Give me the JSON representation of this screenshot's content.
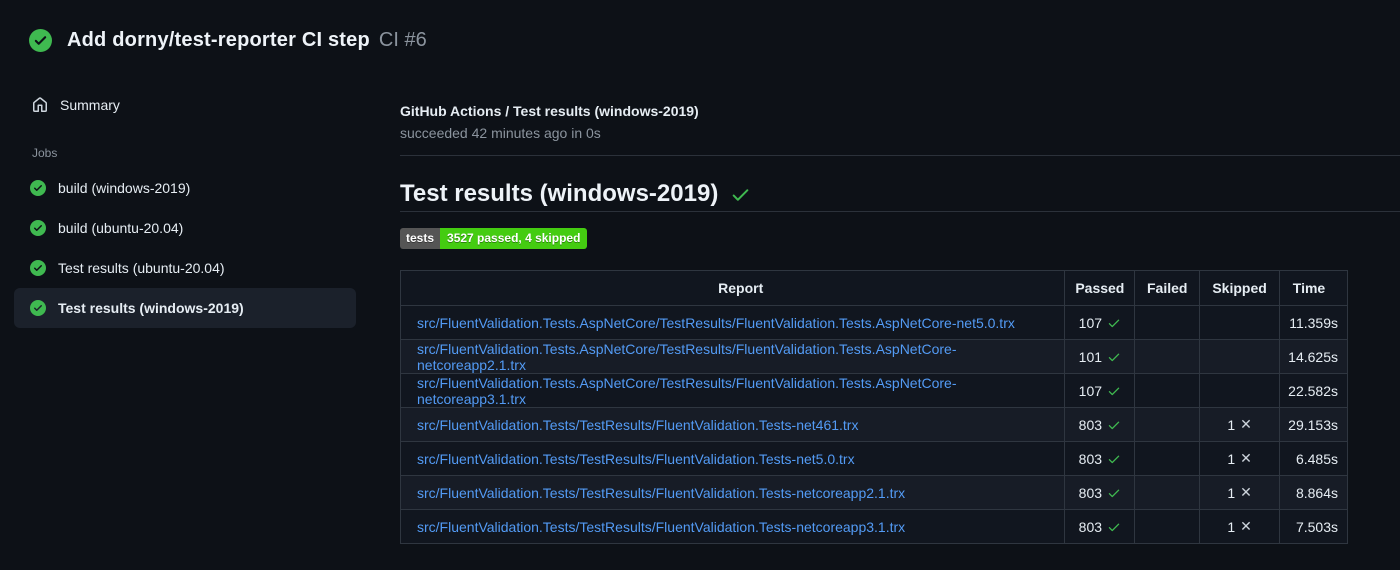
{
  "run_header": {
    "title": "Add dorny/test-reporter CI step",
    "run_number": "CI #6",
    "status": "success"
  },
  "sidebar": {
    "summary_label": "Summary",
    "jobs_label": "Jobs",
    "jobs": [
      {
        "label": "build (windows-2019)",
        "status": "success",
        "selected": false
      },
      {
        "label": "build (ubuntu-20.04)",
        "status": "success",
        "selected": false
      },
      {
        "label": "Test results (ubuntu-20.04)",
        "status": "success",
        "selected": false
      },
      {
        "label": "Test results (windows-2019)",
        "status": "success",
        "selected": true
      }
    ]
  },
  "check_header": {
    "title": "GitHub Actions / Test results (windows-2019)",
    "status_line": "succeeded 42 minutes ago in 0s"
  },
  "report": {
    "heading": "Test results (windows-2019)",
    "heading_status": "success",
    "badge": {
      "label": "tests",
      "value": "3527 passed, 4 skipped",
      "label_bg": "#555555",
      "value_bg": "#44cc11"
    },
    "table": {
      "columns": [
        "Report",
        "Passed",
        "Failed",
        "Skipped",
        "Time"
      ],
      "rows": [
        {
          "report": "src/FluentValidation.Tests.AspNetCore/TestResults/FluentValidation.Tests.AspNetCore-net5.0.trx",
          "passed": "107",
          "failed": "",
          "skipped": "",
          "time": "11.359s"
        },
        {
          "report": "src/FluentValidation.Tests.AspNetCore/TestResults/FluentValidation.Tests.AspNetCore-netcoreapp2.1.trx",
          "passed": "101",
          "failed": "",
          "skipped": "",
          "time": "14.625s"
        },
        {
          "report": "src/FluentValidation.Tests.AspNetCore/TestResults/FluentValidation.Tests.AspNetCore-netcoreapp3.1.trx",
          "passed": "107",
          "failed": "",
          "skipped": "",
          "time": "22.582s"
        },
        {
          "report": "src/FluentValidation.Tests/TestResults/FluentValidation.Tests-net461.trx",
          "passed": "803",
          "failed": "",
          "skipped": "1",
          "time": "29.153s"
        },
        {
          "report": "src/FluentValidation.Tests/TestResults/FluentValidation.Tests-net5.0.trx",
          "passed": "803",
          "failed": "",
          "skipped": "1",
          "time": "6.485s"
        },
        {
          "report": "src/FluentValidation.Tests/TestResults/FluentValidation.Tests-netcoreapp2.1.trx",
          "passed": "803",
          "failed": "",
          "skipped": "1",
          "time": "8.864s"
        },
        {
          "report": "src/FluentValidation.Tests/TestResults/FluentValidation.Tests-netcoreapp3.1.trx",
          "passed": "803",
          "failed": "",
          "skipped": "1",
          "time": "7.503s"
        }
      ]
    }
  },
  "colors": {
    "page_bg": "#0d1117",
    "accent_green": "#3fb950",
    "link_blue": "#539bf5",
    "muted_text": "#8b949e",
    "table_border": "#2f3640"
  }
}
